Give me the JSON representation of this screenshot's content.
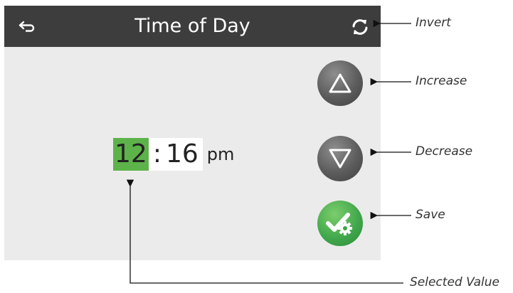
{
  "header": {
    "title": "Time of Day",
    "back_icon": "back-arrow-icon",
    "invert_icon": "refresh-icon"
  },
  "time": {
    "hours": "12",
    "separator": ":",
    "minutes": "16",
    "period": "pm",
    "selected_field": "hours"
  },
  "buttons": {
    "increase_icon": "triangle-up-icon",
    "decrease_icon": "triangle-down-icon",
    "save_icon": "check-gear-icon"
  },
  "callouts": {
    "invert": "Invert",
    "increase": "Increase",
    "decrease": "Decrease",
    "save": "Save",
    "selected_value": "Selected Value"
  },
  "colors": {
    "header_bg": "#3d3d3d",
    "panel_bg": "#ebebeb",
    "selected_highlight": "#5db34a",
    "save_green": "#3ea54a",
    "button_gray": "#5c5c5c"
  }
}
